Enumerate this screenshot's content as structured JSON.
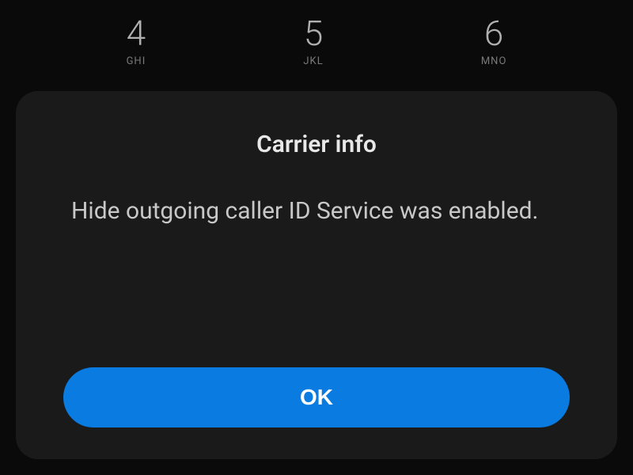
{
  "dialpad": {
    "keys": [
      {
        "digit": "4",
        "letters": "GHI"
      },
      {
        "digit": "5",
        "letters": "JKL"
      },
      {
        "digit": "6",
        "letters": "MNO"
      }
    ]
  },
  "modal": {
    "title": "Carrier info",
    "message": "Hide outgoing caller ID Service was enabled.",
    "ok_label": "OK"
  },
  "colors": {
    "background": "#0a0a0a",
    "modal_bg": "#1a1a1a",
    "button_bg": "#0a7be0",
    "text_primary": "#e8e8e8",
    "text_secondary": "#c8c8c8"
  }
}
